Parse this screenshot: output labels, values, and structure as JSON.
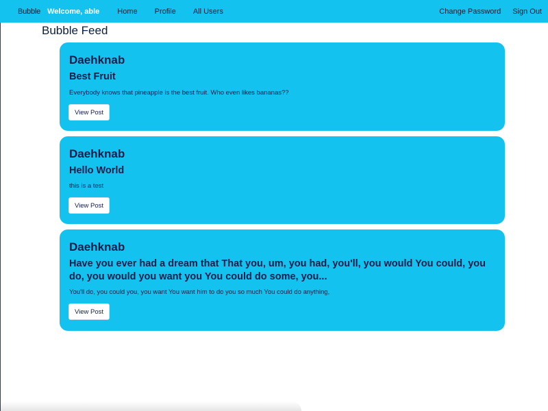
{
  "nav": {
    "brand": "Bubble",
    "welcome": "Welcome, able",
    "links_left": [
      "Home",
      "Profile",
      "All Users"
    ],
    "links_right": [
      "Change Password",
      "Sign Out"
    ]
  },
  "feed": {
    "title": "Bubble Feed",
    "posts": [
      {
        "author": "Daehknab",
        "title": "Best Fruit",
        "body": "Everybody knows that pineapple is the best fruit. Who even likes bananas??",
        "button": "View Post"
      },
      {
        "author": "Daehknab",
        "title": "Hello World",
        "body": "this is a test",
        "button": "View Post"
      },
      {
        "author": "Daehknab",
        "title": "Have you ever had a dream that That you, um, you had, you'll, you would You could, you do, you would you want you You could do some, you...",
        "body": "You'll do, you could you, you want You want him to do you so much You could do anything,",
        "button": "View Post"
      }
    ]
  },
  "colors": {
    "accent": "#13c2ee",
    "text_dark": "#0f1d4a",
    "welcome_text": "#ffffff"
  }
}
